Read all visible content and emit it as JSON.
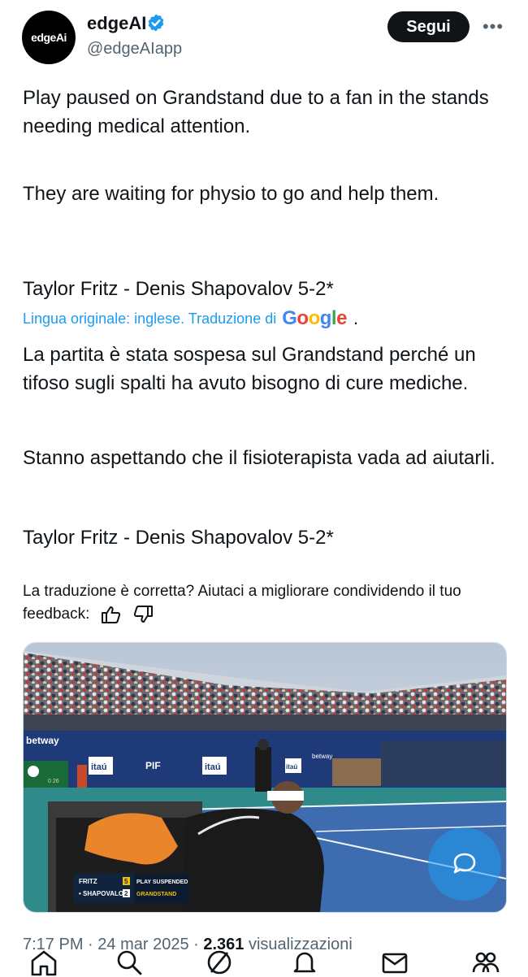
{
  "account": {
    "display_name": "edgeAI",
    "handle": "@edgeAIapp",
    "avatar_text": "edgeAi",
    "verified": true
  },
  "actions": {
    "follow_label": "Segui",
    "more_label": "•••"
  },
  "tweet": {
    "paragraph_1": "Play paused on Grandstand due to a fan in the stands needing medical attention.",
    "paragraph_2": "They are waiting for physio to go and help them.",
    "paragraph_3": "Taylor Fritz - Denis Shapovalov 5-2*"
  },
  "translation": {
    "source_note": "Lingua originale: inglese. Traduzione di",
    "provider": "Google",
    "paragraph_1": "La partita è stata sospesa sul Grandstand perché un tifoso sugli spalti ha avuto bisogno di cure mediche.",
    "paragraph_2": "Stanno aspettando che il fisioterapista vada ad aiutarli.",
    "paragraph_3": "Taylor Fritz - Denis Shapovalov 5-2*"
  },
  "feedback": {
    "prompt": "La traduzione è corretta? Aiutaci a migliorare condividendo il tuo feedback:"
  },
  "media": {
    "scoreboard": {
      "player_1": "FRITZ",
      "player_1_score": "5",
      "player_2": "• SHAPOVALOV",
      "player_2_score": "2",
      "status": "PLAY SUSPENDED",
      "court": "GRANDSTAND"
    },
    "ads": [
      "betway",
      "itaú",
      "PIF",
      "itaú",
      "itaú",
      "betway"
    ],
    "rolex_score": "0 26"
  },
  "meta": {
    "time": "7:17 PM",
    "date": "24 mar 2025",
    "views_count": "2.361",
    "views_label": "visualizzazioni"
  },
  "colors": {
    "accent": "#1d9bf0",
    "text": "#0f1419",
    "muted": "#536471"
  }
}
